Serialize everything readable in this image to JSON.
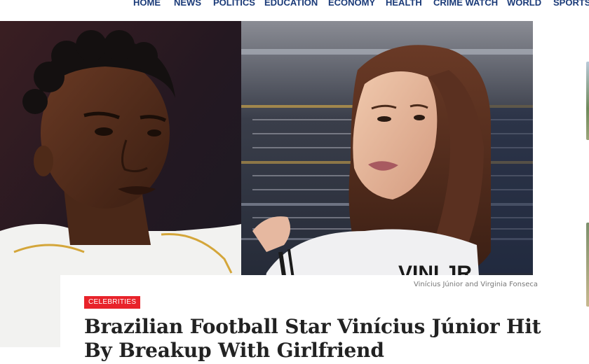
{
  "nav": {
    "items": [
      "HOME",
      "NEWS",
      "POLITICS",
      "EDUCATION",
      "ECONOMY",
      "HEALTH",
      "CRIME WATCH",
      "WORLD",
      "SPORTS"
    ]
  },
  "hero": {
    "jersey_text": "VINI JR."
  },
  "article": {
    "image_caption": "Vinícius Júnior and Virginia Fonseca",
    "category": "CELEBRITIES",
    "title": "Brazilian Football Star Vinícius Júnior Hit By Breakup With Girlfriend"
  },
  "colors": {
    "nav_text": "#1a3a78",
    "category_badge": "#e8232a",
    "title_text": "#222222",
    "caption_text": "#777777"
  }
}
